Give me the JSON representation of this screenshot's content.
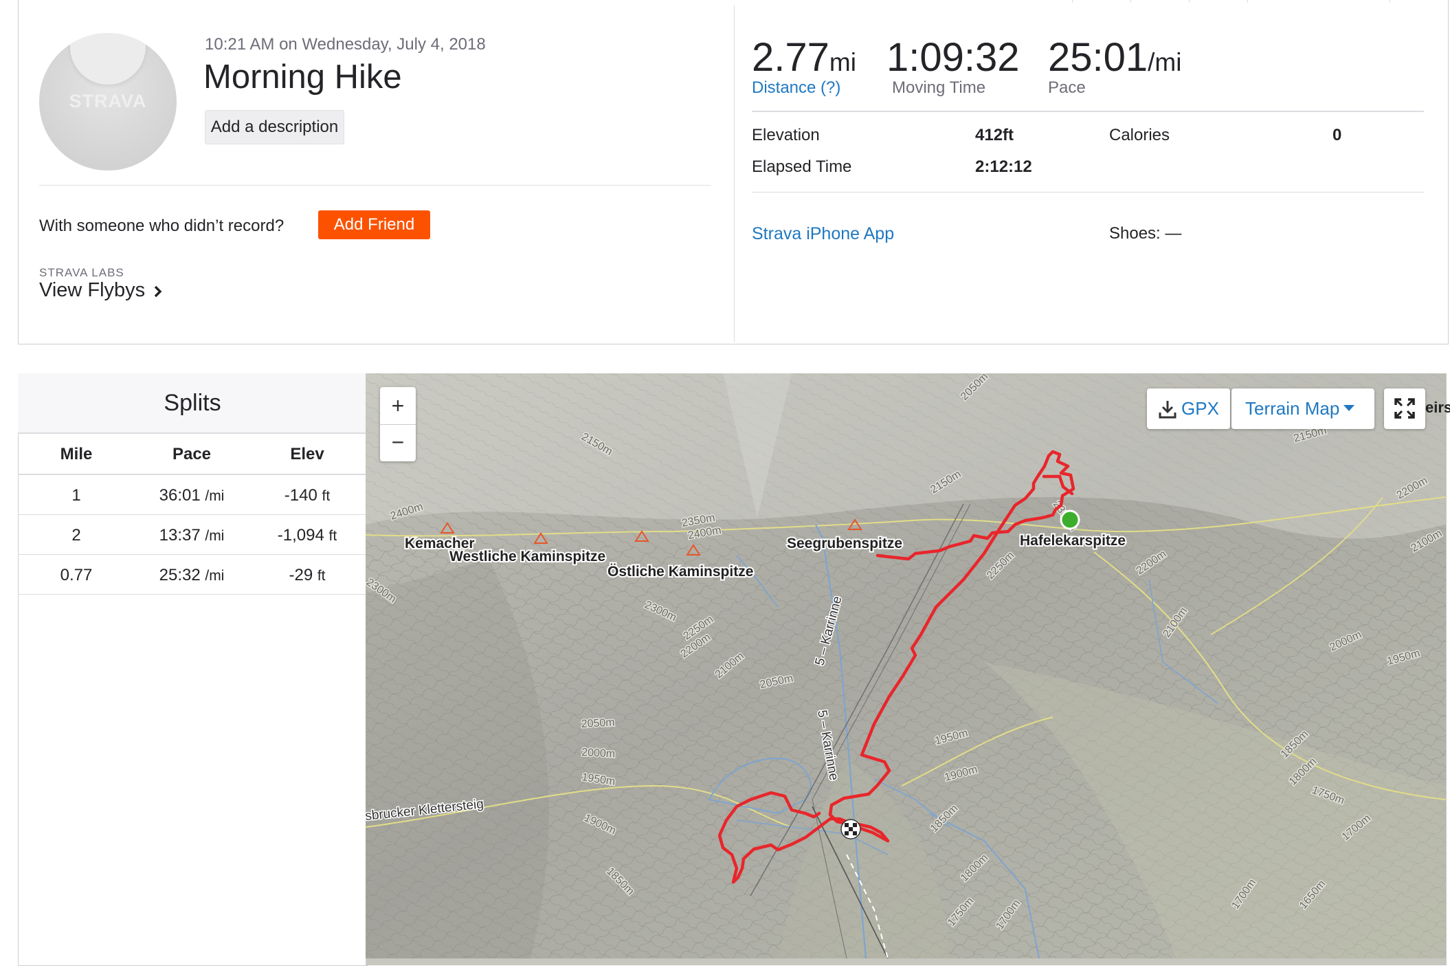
{
  "activity": {
    "datetime": "10:21 AM on Wednesday, July 4, 2018",
    "title": "Morning Hike",
    "add_description_label": "Add a description",
    "avatar_wordmark": "STRAVA",
    "with_someone_text": "With someone who didn’t record?",
    "add_friend_label": "Add Friend",
    "strava_labs_label": "STRAVA LABS",
    "view_flybys_label": "View Flybys"
  },
  "stats": {
    "distance": {
      "value": "2.77",
      "unit": "mi",
      "label": "Distance (?)"
    },
    "moving_time": {
      "value": "1:09:32",
      "label": "Moving Time"
    },
    "pace": {
      "value": "25:01",
      "unit": "/mi",
      "label": "Pace"
    },
    "elevation": {
      "label": "Elevation",
      "value": "412ft"
    },
    "calories": {
      "label": "Calories",
      "value": "0"
    },
    "elapsed_time": {
      "label": "Elapsed Time",
      "value": "2:12:12"
    },
    "device": "Strava iPhone App",
    "shoes": "Shoes: —"
  },
  "splits": {
    "title": "Splits",
    "columns": [
      "Mile",
      "Pace",
      "Elev"
    ],
    "rows": [
      {
        "mile": "1",
        "pace": "36:01",
        "pace_unit": "/mi",
        "elev": "-140",
        "elev_unit": "ft"
      },
      {
        "mile": "2",
        "pace": "13:37",
        "pace_unit": "/mi",
        "elev": "-1,094",
        "elev_unit": "ft"
      },
      {
        "mile": "0.77",
        "pace": "25:32",
        "pace_unit": "/mi",
        "elev": "-29",
        "elev_unit": "ft"
      }
    ]
  },
  "map": {
    "zoom_in": "+",
    "zoom_out": "−",
    "gpx_label": "GPX",
    "terrain_label": "Terrain Map",
    "partial_edge_label": "eirs",
    "peaks": [
      "Kemacher",
      "Westliche Kaminspitze",
      "Östliche Kaminspitze",
      "Seegrubenspitze",
      "Hafelekarspitze"
    ],
    "trails": [
      "5 – Karrinne",
      "5 – Karrinne",
      "sbrucker Klettersteig"
    ],
    "contours": [
      "2050m",
      "2150m",
      "2400m",
      "2350m",
      "2400m",
      "2150m",
      "2300m",
      "2250m",
      "2200m",
      "2100m",
      "2300m",
      "2300m",
      "2250m",
      "2200m",
      "2100m",
      "2050m",
      "2050m",
      "2000m",
      "1950m",
      "1900m",
      "1850m",
      "1950m",
      "1900m",
      "1850m",
      "1800m",
      "1750m",
      "1700m",
      "2000m",
      "1950m",
      "2200m",
      "2100m",
      "2150m",
      "1850m",
      "1800m",
      "1750m",
      "1700m",
      "1650m",
      "1700m"
    ],
    "colors": {
      "route": "#e8262b",
      "start_marker": "#3dae2b",
      "accent": "#fc5200",
      "link": "#1f78c1"
    }
  }
}
